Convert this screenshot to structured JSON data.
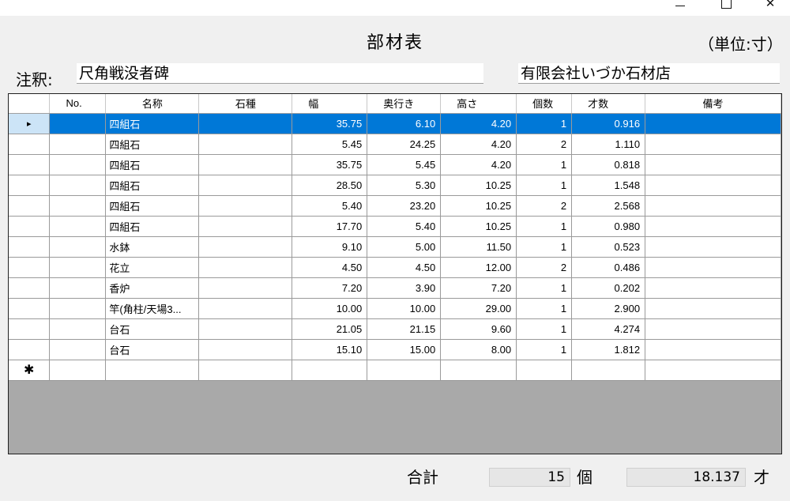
{
  "window": {
    "minimize": "minimize",
    "maximize": "maximize",
    "close": "✕"
  },
  "header": {
    "title": "部材表",
    "unit": "（単位:寸）"
  },
  "note": {
    "label": "注釈:",
    "value": "尺角戦没者碑",
    "company": "有限会社いづか石材店"
  },
  "table": {
    "columns": [
      "No.",
      "名称",
      "石種",
      "幅",
      "奥行き",
      "高さ",
      "個数",
      "才数",
      "備考"
    ],
    "rows": [
      {
        "no": "",
        "name": "四組石",
        "stone": "",
        "w": "35.75",
        "d": "6.10",
        "h": "4.20",
        "qty": "1",
        "sai": "0.916",
        "memo": "",
        "selected": true
      },
      {
        "no": "",
        "name": "四組石",
        "stone": "",
        "w": "5.45",
        "d": "24.25",
        "h": "4.20",
        "qty": "2",
        "sai": "1.110",
        "memo": ""
      },
      {
        "no": "",
        "name": "四組石",
        "stone": "",
        "w": "35.75",
        "d": "5.45",
        "h": "4.20",
        "qty": "1",
        "sai": "0.818",
        "memo": ""
      },
      {
        "no": "",
        "name": "四組石",
        "stone": "",
        "w": "28.50",
        "d": "5.30",
        "h": "10.25",
        "qty": "1",
        "sai": "1.548",
        "memo": ""
      },
      {
        "no": "",
        "name": "四組石",
        "stone": "",
        "w": "5.40",
        "d": "23.20",
        "h": "10.25",
        "qty": "2",
        "sai": "2.568",
        "memo": ""
      },
      {
        "no": "",
        "name": "四組石",
        "stone": "",
        "w": "17.70",
        "d": "5.40",
        "h": "10.25",
        "qty": "1",
        "sai": "0.980",
        "memo": ""
      },
      {
        "no": "",
        "name": "水鉢",
        "stone": "",
        "w": "9.10",
        "d": "5.00",
        "h": "11.50",
        "qty": "1",
        "sai": "0.523",
        "memo": ""
      },
      {
        "no": "",
        "name": "花立",
        "stone": "",
        "w": "4.50",
        "d": "4.50",
        "h": "12.00",
        "qty": "2",
        "sai": "0.486",
        "memo": ""
      },
      {
        "no": "",
        "name": "香炉",
        "stone": "",
        "w": "7.20",
        "d": "3.90",
        "h": "7.20",
        "qty": "1",
        "sai": "0.202",
        "memo": ""
      },
      {
        "no": "",
        "name": "竿(角柱/天場3...",
        "stone": "",
        "w": "10.00",
        "d": "10.00",
        "h": "29.00",
        "qty": "1",
        "sai": "2.900",
        "memo": ""
      },
      {
        "no": "",
        "name": "台石",
        "stone": "",
        "w": "21.05",
        "d": "21.15",
        "h": "9.60",
        "qty": "1",
        "sai": "4.274",
        "memo": ""
      },
      {
        "no": "",
        "name": "台石",
        "stone": "",
        "w": "15.10",
        "d": "15.00",
        "h": "8.00",
        "qty": "1",
        "sai": "1.812",
        "memo": ""
      }
    ],
    "current_row_marker": "▸",
    "new_row_marker": "✱"
  },
  "footer": {
    "total_label": "合計",
    "count_value": "15",
    "count_unit": "個",
    "sai_value": "18.137",
    "sai_unit": "才"
  },
  "colors": {
    "selection": "#0078d7",
    "row_header_selected": "#cce4f7",
    "grid_empty": "#a9a9a9",
    "form_bg": "#f0f0f0"
  },
  "icons": {
    "minimize": "minimize-icon",
    "maximize": "maximize-icon",
    "close": "close-icon",
    "current_row": "current-row-arrow-icon",
    "new_row": "new-row-star-icon"
  }
}
